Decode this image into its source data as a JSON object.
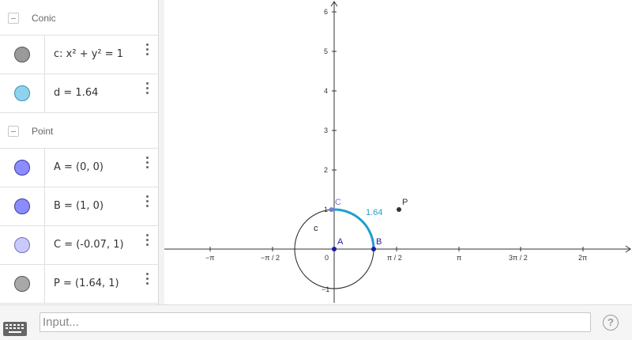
{
  "algebra": {
    "groups": [
      {
        "title": "Conic",
        "items": [
          {
            "text": "c: x² + y² = 1",
            "color": "#9a9a9a"
          },
          {
            "text": "d = 1.64",
            "color": "#8ed3ee"
          }
        ]
      },
      {
        "title": "Point",
        "items": [
          {
            "text": "A = (0, 0)",
            "color": "#8c8cff"
          },
          {
            "text": "B = (1, 0)",
            "color": "#8c8cff"
          },
          {
            "text": "C = (-0.07, 1)",
            "color": "#c9c9ff"
          },
          {
            "text": "P = (1.64, 1)",
            "color": "#a8a8a8"
          }
        ]
      }
    ]
  },
  "graphics": {
    "x_ticks": [
      "−π",
      "−π / 2",
      "0",
      "π / 2",
      "π",
      "3π / 2",
      "2π"
    ],
    "y_ticks": [
      "6",
      "5",
      "4",
      "3",
      "2",
      "1",
      "−1"
    ],
    "circle_label": "c",
    "arc_label": "1.64",
    "points": {
      "A": "A",
      "B": "B",
      "C": "C",
      "P": "P"
    },
    "colors": {
      "arc": "#1e9fcc",
      "point_blue": "#1a1aa8",
      "point_gray": "#333333",
      "axis": "#333333"
    }
  },
  "input_bar": {
    "placeholder": "Input...",
    "help_icon": "?"
  }
}
